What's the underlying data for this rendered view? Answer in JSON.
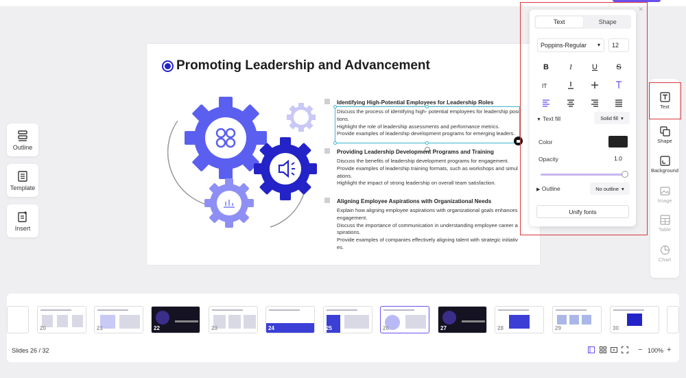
{
  "left_tools": [
    {
      "label": "Outline",
      "icon": "outline-icon"
    },
    {
      "label": "Template",
      "icon": "template-icon"
    },
    {
      "label": "Insert",
      "icon": "insert-icon"
    }
  ],
  "slide": {
    "title": "Promoting Leadership and Advancement",
    "sections": [
      {
        "heading": "Identifying High-Potential Employees for Leadership Roles",
        "lines": [
          "Discuss the process of identifying high- potential employees for leadership positions.",
          "Highlight the role of leadership assessments and performance metrics.",
          "Provide examples of leadership development programs for emerging leaders."
        ]
      },
      {
        "heading": "Providing Leadership Development Programs and Training",
        "lines": [
          "Discuss the benefits of leadership development programs for engagement.",
          "Provide examples of leadership training formats, such as workshops and simulations.",
          "Highlight the impact of strong leadership on overall team satisfaction."
        ]
      },
      {
        "heading": "Aligning Employee Aspirations with Organizational Needs",
        "lines": [
          "Explain how aligning employee aspirations with organizational goals enhances engagement.",
          "Discuss the importance of communication in understanding employee career aspirations.",
          "Provide examples of companies effectively aligning talent with strategic initiatives."
        ]
      }
    ]
  },
  "text_panel": {
    "tabs": [
      "Text",
      "Shape"
    ],
    "active_tab": "Text",
    "font": "Poppins-Regular",
    "font_size": "12",
    "text_fill_label": "Text fill",
    "text_fill_value": "Solid fill",
    "color_label": "Color",
    "color_value": "#222222",
    "opacity_label": "Opacity",
    "opacity_value": "1.0",
    "outline_label": "Outline",
    "outline_value": "No outline",
    "unify_label": "Unify fonts",
    "close": "×"
  },
  "right_sidebar": [
    {
      "label": "Text",
      "icon": "text-box-icon",
      "active": true
    },
    {
      "label": "Shape",
      "icon": "shape-icon",
      "active": false
    },
    {
      "label": "Background",
      "icon": "background-icon",
      "active": false
    },
    {
      "label": "Image",
      "icon": "image-icon",
      "disabled": true
    },
    {
      "label": "Table",
      "icon": "table-icon",
      "disabled": true
    },
    {
      "label": "Chart",
      "icon": "chart-icon",
      "disabled": true
    }
  ],
  "filmstrip": {
    "thumbnails": [
      {
        "num": "20",
        "style": "light"
      },
      {
        "num": "21",
        "style": "light"
      },
      {
        "num": "22",
        "style": "dark"
      },
      {
        "num": "23",
        "style": "light"
      },
      {
        "num": "24",
        "style": "blue"
      },
      {
        "num": "25",
        "style": "light"
      },
      {
        "num": "26",
        "style": "selected"
      },
      {
        "num": "27",
        "style": "dark"
      },
      {
        "num": "28",
        "style": "light"
      },
      {
        "num": "29",
        "style": "light"
      },
      {
        "num": "30",
        "style": "light"
      }
    ],
    "slides_label": "Slides",
    "current": "26",
    "total": "32",
    "counter_text": "Slides  26 / 32"
  },
  "zoom": {
    "value": "100%",
    "minus": "−",
    "plus": "+"
  },
  "colors": {
    "accent": "#6b4ff0",
    "primary_gear": "#5b5ff0",
    "dark_gear": "#2323c8",
    "highlight_outline": "#d9373a"
  }
}
